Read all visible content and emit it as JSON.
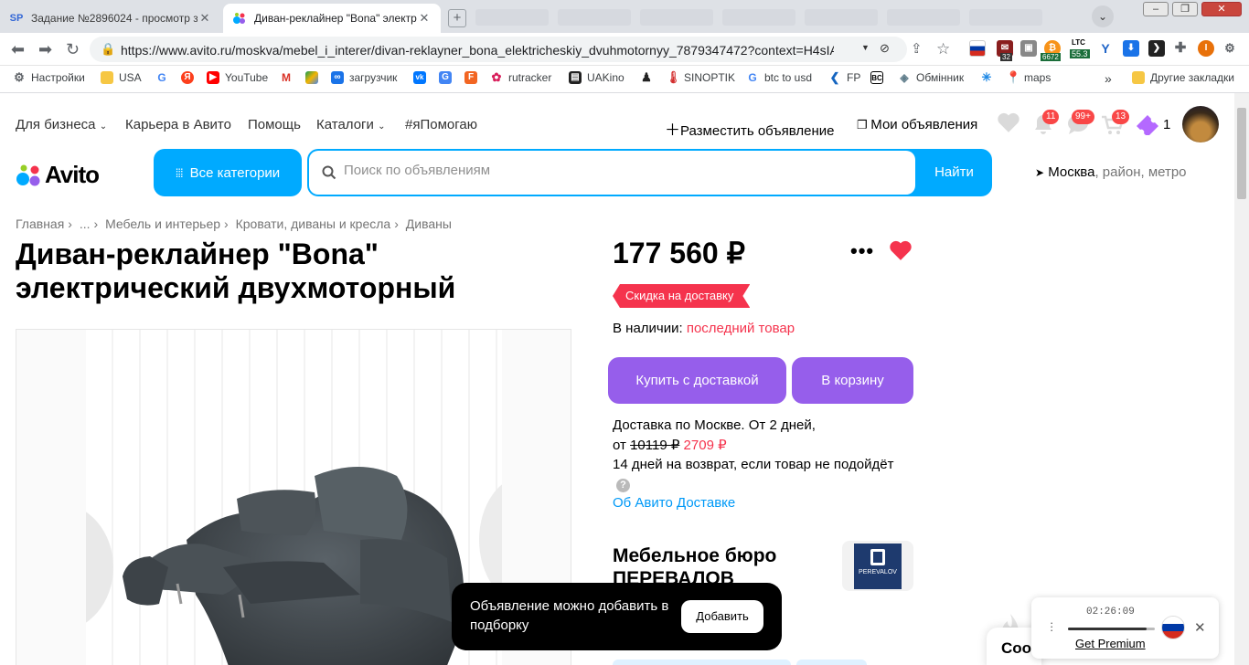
{
  "browser": {
    "tabs": [
      {
        "title": "Задание №2896024 - просмотр за",
        "icon": "sp-icon",
        "active": false
      },
      {
        "title": "Диван-реклайнер \"Bona\" электри",
        "icon": "avito-icon",
        "active": true
      }
    ],
    "url": "https://www.avito.ru/moskva/mebel_i_interer/divan-reklayner_bona_elektricheskiy_dvuhmotornyy_7879347472?context=H4sIAAA...",
    "extensions": {
      "mail_count": "32",
      "btc_value": "6672",
      "ltc_label": "LTC",
      "ltc_value": "55.3",
      "profile_letter": "I"
    },
    "bookmarks": [
      {
        "label": "Настройки",
        "icon": "gear-icon"
      },
      {
        "label": "USA",
        "icon": "folder-icon"
      },
      {
        "label": "",
        "icon": "google-icon"
      },
      {
        "label": "",
        "icon": "yandex-icon"
      },
      {
        "label": "YouTube",
        "icon": "youtube-icon"
      },
      {
        "label": "",
        "icon": "gmail-icon"
      },
      {
        "label": "",
        "icon": "drive-icon"
      },
      {
        "label": "загрузчик",
        "icon": "infinity-icon"
      },
      {
        "label": "",
        "icon": "vk-icon"
      },
      {
        "label": "",
        "icon": "translate-icon"
      },
      {
        "label": "",
        "icon": "f-icon"
      },
      {
        "label": "rutracker",
        "icon": "rutracker-icon"
      },
      {
        "label": "UAKino",
        "icon": "uakino-icon"
      },
      {
        "label": "",
        "icon": "figure-icon"
      },
      {
        "label": "SINOPTIK",
        "icon": "thermometer-icon"
      },
      {
        "label": "btc to usd",
        "icon": "google-icon"
      },
      {
        "label": "FP",
        "icon": "fp-icon"
      },
      {
        "label": "",
        "icon": "bc-icon"
      },
      {
        "label": "Обмінник",
        "icon": "exchange-icon"
      },
      {
        "label": "",
        "icon": "star-icon"
      },
      {
        "label": "maps",
        "icon": "maps-icon"
      }
    ],
    "bookmarks_overflow": "»",
    "other_bookmarks": "Другие закладки"
  },
  "topnav": {
    "left": [
      "Для бизнеса",
      "Карьера в Авито",
      "Помощь",
      "Каталоги",
      "#яПомогаю"
    ],
    "place_ad": "Разместить объявление",
    "my_ads": "Мои объявления",
    "notifications_badge": "11",
    "messages_badge": "99+",
    "cart_badge": "13",
    "bonus_count": "1"
  },
  "header": {
    "logo": "Avito",
    "all_categories": "Все категории",
    "search_placeholder": "Поиск по объявлениям",
    "search_button": "Найти",
    "location_city": "Москва",
    "location_rest": ", район, метро"
  },
  "breadcrumb": [
    "Главная",
    "...",
    "Мебель и интерьер",
    "Кровати, диваны и кресла",
    "Диваны"
  ],
  "item": {
    "title": "Диван-реклайнер \"Bona\" электрический двухмоторный",
    "price": "177 560 ₽",
    "discount_tag": "Скидка на доставку",
    "stock_label": "В наличии: ",
    "stock_value": "последний товар",
    "buy_button": "Купить с доставкой",
    "cart_button": "В корзину",
    "delivery_line1": "Доставка по Москве. От 2 дней,",
    "delivery_from": "от ",
    "delivery_old_price": "10119 ₽",
    "delivery_new_price": "2709 ₽",
    "return_text": "14 дней на возврат, если товар не подойдёт",
    "about_delivery": "Об Авито Доставке",
    "seller_name": "Мебельное бюро ПЕРЕВАЛОВ",
    "seller_logo_text": "PEREVALOV"
  },
  "toast": {
    "text": "Объявление можно добавить в подборку",
    "button": "Добавить"
  },
  "cookie": {
    "text": "Coo"
  },
  "vpn": {
    "time": "02:26:09",
    "link": "Get Premium",
    "progress": 0.9
  },
  "colors": {
    "avito_blue": "#00aaff",
    "purple": "#965eeb",
    "red": "#f5334d",
    "link": "#0099f7"
  }
}
